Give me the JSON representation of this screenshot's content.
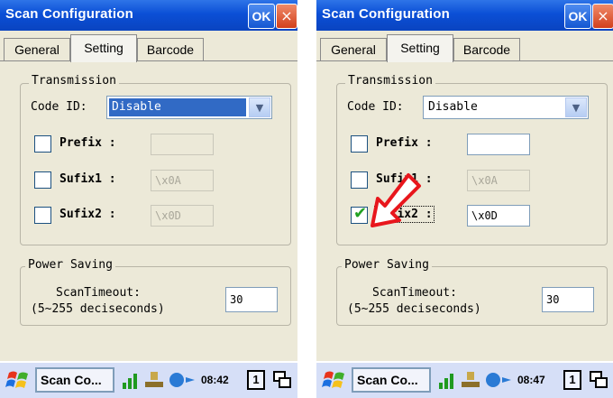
{
  "screens": [
    {
      "title": "Scan Configuration",
      "ok_label": "OK",
      "close_label": "×",
      "tabs": [
        "General",
        "Setting",
        "Barcode"
      ],
      "transmission": {
        "legend": "Transmission",
        "code_id_label": "Code ID:",
        "code_id_value": "Disable",
        "prefix_label": "Prefix :",
        "prefix_value": "",
        "prefix_checked": false,
        "sufix1_label": "Sufix1 :",
        "sufix1_value": "\\x0A",
        "sufix1_checked": false,
        "sufix2_label": "Sufix2 :",
        "sufix2_value": "\\x0D",
        "sufix2_checked": false
      },
      "power": {
        "legend": "Power Saving",
        "label_line1": "ScanTimeout:",
        "label_line2": "(5~255 deciseconds)",
        "value": "30"
      },
      "taskbar": {
        "app_label": "Scan Co...",
        "clock": "08:42",
        "kb_label": "1"
      }
    },
    {
      "title": "Scan Configuration",
      "ok_label": "OK",
      "close_label": "×",
      "tabs": [
        "General",
        "Setting",
        "Barcode"
      ],
      "transmission": {
        "legend": "Transmission",
        "code_id_label": "Code ID:",
        "code_id_value": "Disable",
        "prefix_label": "Prefix :",
        "prefix_value": "",
        "prefix_checked": false,
        "sufix1_label": "Sufix1 :",
        "sufix1_value": "\\x0A",
        "sufix1_checked": false,
        "sufix2_label": "Sufix2 :",
        "sufix2_value": "\\x0D",
        "sufix2_checked": true
      },
      "power": {
        "legend": "Power Saving",
        "label_line1": "ScanTimeout:",
        "label_line2": "(5~255 deciseconds)",
        "value": "30"
      },
      "taskbar": {
        "app_label": "Scan Co...",
        "clock": "08:47",
        "kb_label": "1"
      }
    }
  ],
  "colors": {
    "titlebar": "#0b4fd6",
    "selection": "#316ac5",
    "annotation_arrow": "#e8161c",
    "checkmark": "#21a121"
  },
  "icons": [
    "windows-start-icon",
    "signal-icon",
    "network-icon",
    "sync-icon",
    "keyboard-icon",
    "window-switch-icon",
    "down-arrow-icon",
    "checkmark-icon"
  ]
}
